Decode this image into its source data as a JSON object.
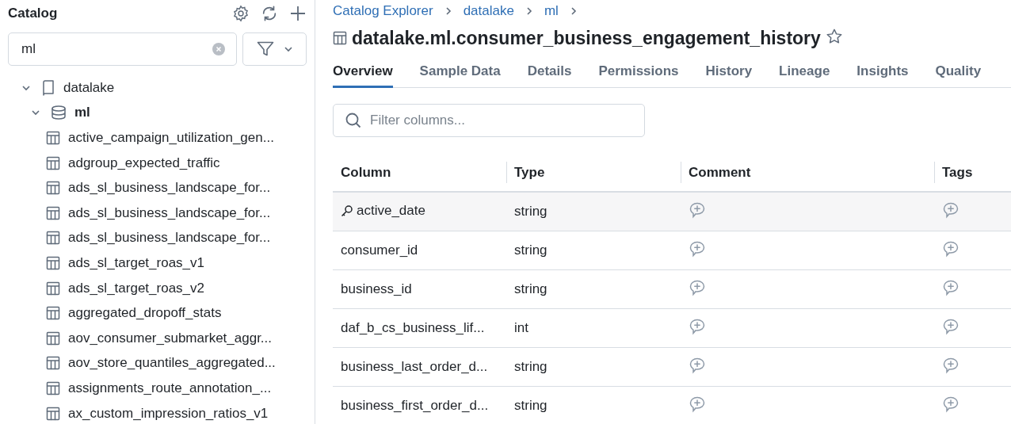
{
  "sidebar": {
    "title": "Catalog",
    "search": {
      "value": "ml"
    },
    "tree": [
      {
        "label": "datalake",
        "kind": "catalog",
        "expanded": true,
        "children": [
          {
            "label": "ml",
            "kind": "schema",
            "expanded": true,
            "children": [
              {
                "label": "active_campaign_utilization_gen...",
                "kind": "table"
              },
              {
                "label": "adgroup_expected_traffic",
                "kind": "table"
              },
              {
                "label": "ads_sl_business_landscape_for...",
                "kind": "table"
              },
              {
                "label": "ads_sl_business_landscape_for...",
                "kind": "table"
              },
              {
                "label": "ads_sl_business_landscape_for...",
                "kind": "table"
              },
              {
                "label": "ads_sl_target_roas_v1",
                "kind": "table"
              },
              {
                "label": "ads_sl_target_roas_v2",
                "kind": "table"
              },
              {
                "label": "aggregated_dropoff_stats",
                "kind": "table"
              },
              {
                "label": "aov_consumer_submarket_aggr...",
                "kind": "table"
              },
              {
                "label": "aov_store_quantiles_aggregated...",
                "kind": "table"
              },
              {
                "label": "assignments_route_annotation_...",
                "kind": "table"
              },
              {
                "label": "ax_custom_impression_ratios_v1",
                "kind": "table"
              }
            ]
          }
        ]
      }
    ]
  },
  "breadcrumbs": [
    "Catalog Explorer",
    "datalake",
    "ml"
  ],
  "title": "datalake.ml.consumer_business_engagement_history",
  "favorite": false,
  "tabs": [
    {
      "label": "Overview",
      "selected": true
    },
    {
      "label": "Sample Data",
      "selected": false
    },
    {
      "label": "Details",
      "selected": false
    },
    {
      "label": "Permissions",
      "selected": false
    },
    {
      "label": "History",
      "selected": false
    },
    {
      "label": "Lineage",
      "selected": false
    },
    {
      "label": "Insights",
      "selected": false
    },
    {
      "label": "Quality",
      "selected": false
    }
  ],
  "filter": {
    "placeholder": "Filter columns..."
  },
  "table": {
    "columns": [
      "Column",
      "Type",
      "Comment",
      "Tags"
    ],
    "rows": [
      {
        "name": "active_date",
        "type": "string",
        "key": true,
        "highlighted": true
      },
      {
        "name": "consumer_id",
        "type": "string",
        "key": false,
        "highlighted": false
      },
      {
        "name": "business_id",
        "type": "string",
        "key": false,
        "highlighted": false
      },
      {
        "name": "daf_b_cs_business_lif...",
        "type": "int",
        "key": false,
        "highlighted": false
      },
      {
        "name": "business_last_order_d...",
        "type": "string",
        "key": false,
        "highlighted": false
      },
      {
        "name": "business_first_order_d...",
        "type": "string",
        "key": false,
        "highlighted": false
      }
    ]
  }
}
